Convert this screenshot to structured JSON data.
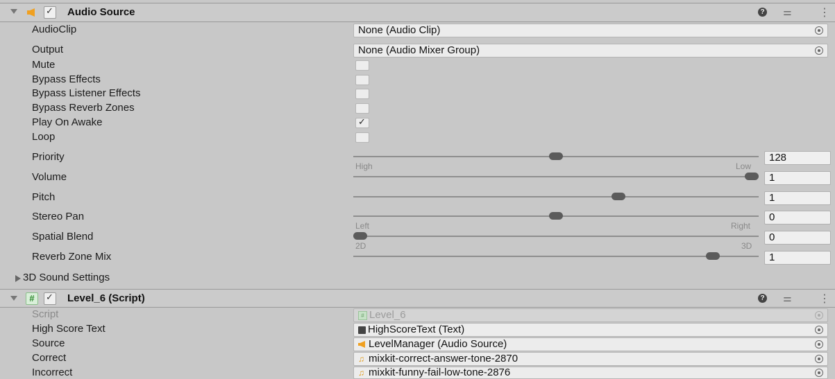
{
  "audio_source": {
    "title": "Audio Source",
    "enabled": true,
    "fields": {
      "audioclip_label": "AudioClip",
      "audioclip_value": "None (Audio Clip)",
      "output_label": "Output",
      "output_value": "None (Audio Mixer Group)"
    },
    "toggles": [
      {
        "label": "Mute",
        "checked": false
      },
      {
        "label": "Bypass Effects",
        "checked": false
      },
      {
        "label": "Bypass Listener Effects",
        "checked": false
      },
      {
        "label": "Bypass Reverb Zones",
        "checked": false
      },
      {
        "label": "Play On Awake",
        "checked": true
      },
      {
        "label": "Loop",
        "checked": false
      }
    ],
    "sliders": [
      {
        "label": "Priority",
        "value": "128",
        "fraction": 0.5,
        "min_label": "High",
        "max_label": "Low"
      },
      {
        "label": "Volume",
        "value": "1",
        "fraction": 1.0
      },
      {
        "label": "Pitch",
        "value": "1",
        "fraction": 0.66
      },
      {
        "label": "Stereo Pan",
        "value": "0",
        "fraction": 0.5,
        "min_label": "Left",
        "max_label": "Right"
      },
      {
        "label": "Spatial Blend",
        "value": "0",
        "fraction": 0.0,
        "min_label": "2D",
        "max_label": "3D"
      },
      {
        "label": "Reverb Zone Mix",
        "value": "1",
        "fraction": 0.9
      }
    ],
    "sound_settings_label": "3D Sound Settings"
  },
  "script_component": {
    "title": "Level_6 (Script)",
    "enabled": true,
    "rows": [
      {
        "label": "Script",
        "value": "Level_6"
      },
      {
        "label": "High Score Text",
        "value": "HighScoreText (Text)"
      },
      {
        "label": "Source",
        "value": "LevelManager (Audio Source)"
      },
      {
        "label": "Correct",
        "value": "mixkit-correct-answer-tone-2870"
      },
      {
        "label": "Incorrect",
        "value": "mixkit-funny-fail-low-tone-2876"
      }
    ]
  },
  "icons": {
    "header_help": "help-icon",
    "header_presets": "presets-icon",
    "header_menu": "kebab-menu-icon",
    "object_picker": "object-picker-icon"
  },
  "colors": {
    "audio_icon": "#f0a020",
    "script_icon": "#4aa84a",
    "background": "#c8c8c8"
  }
}
